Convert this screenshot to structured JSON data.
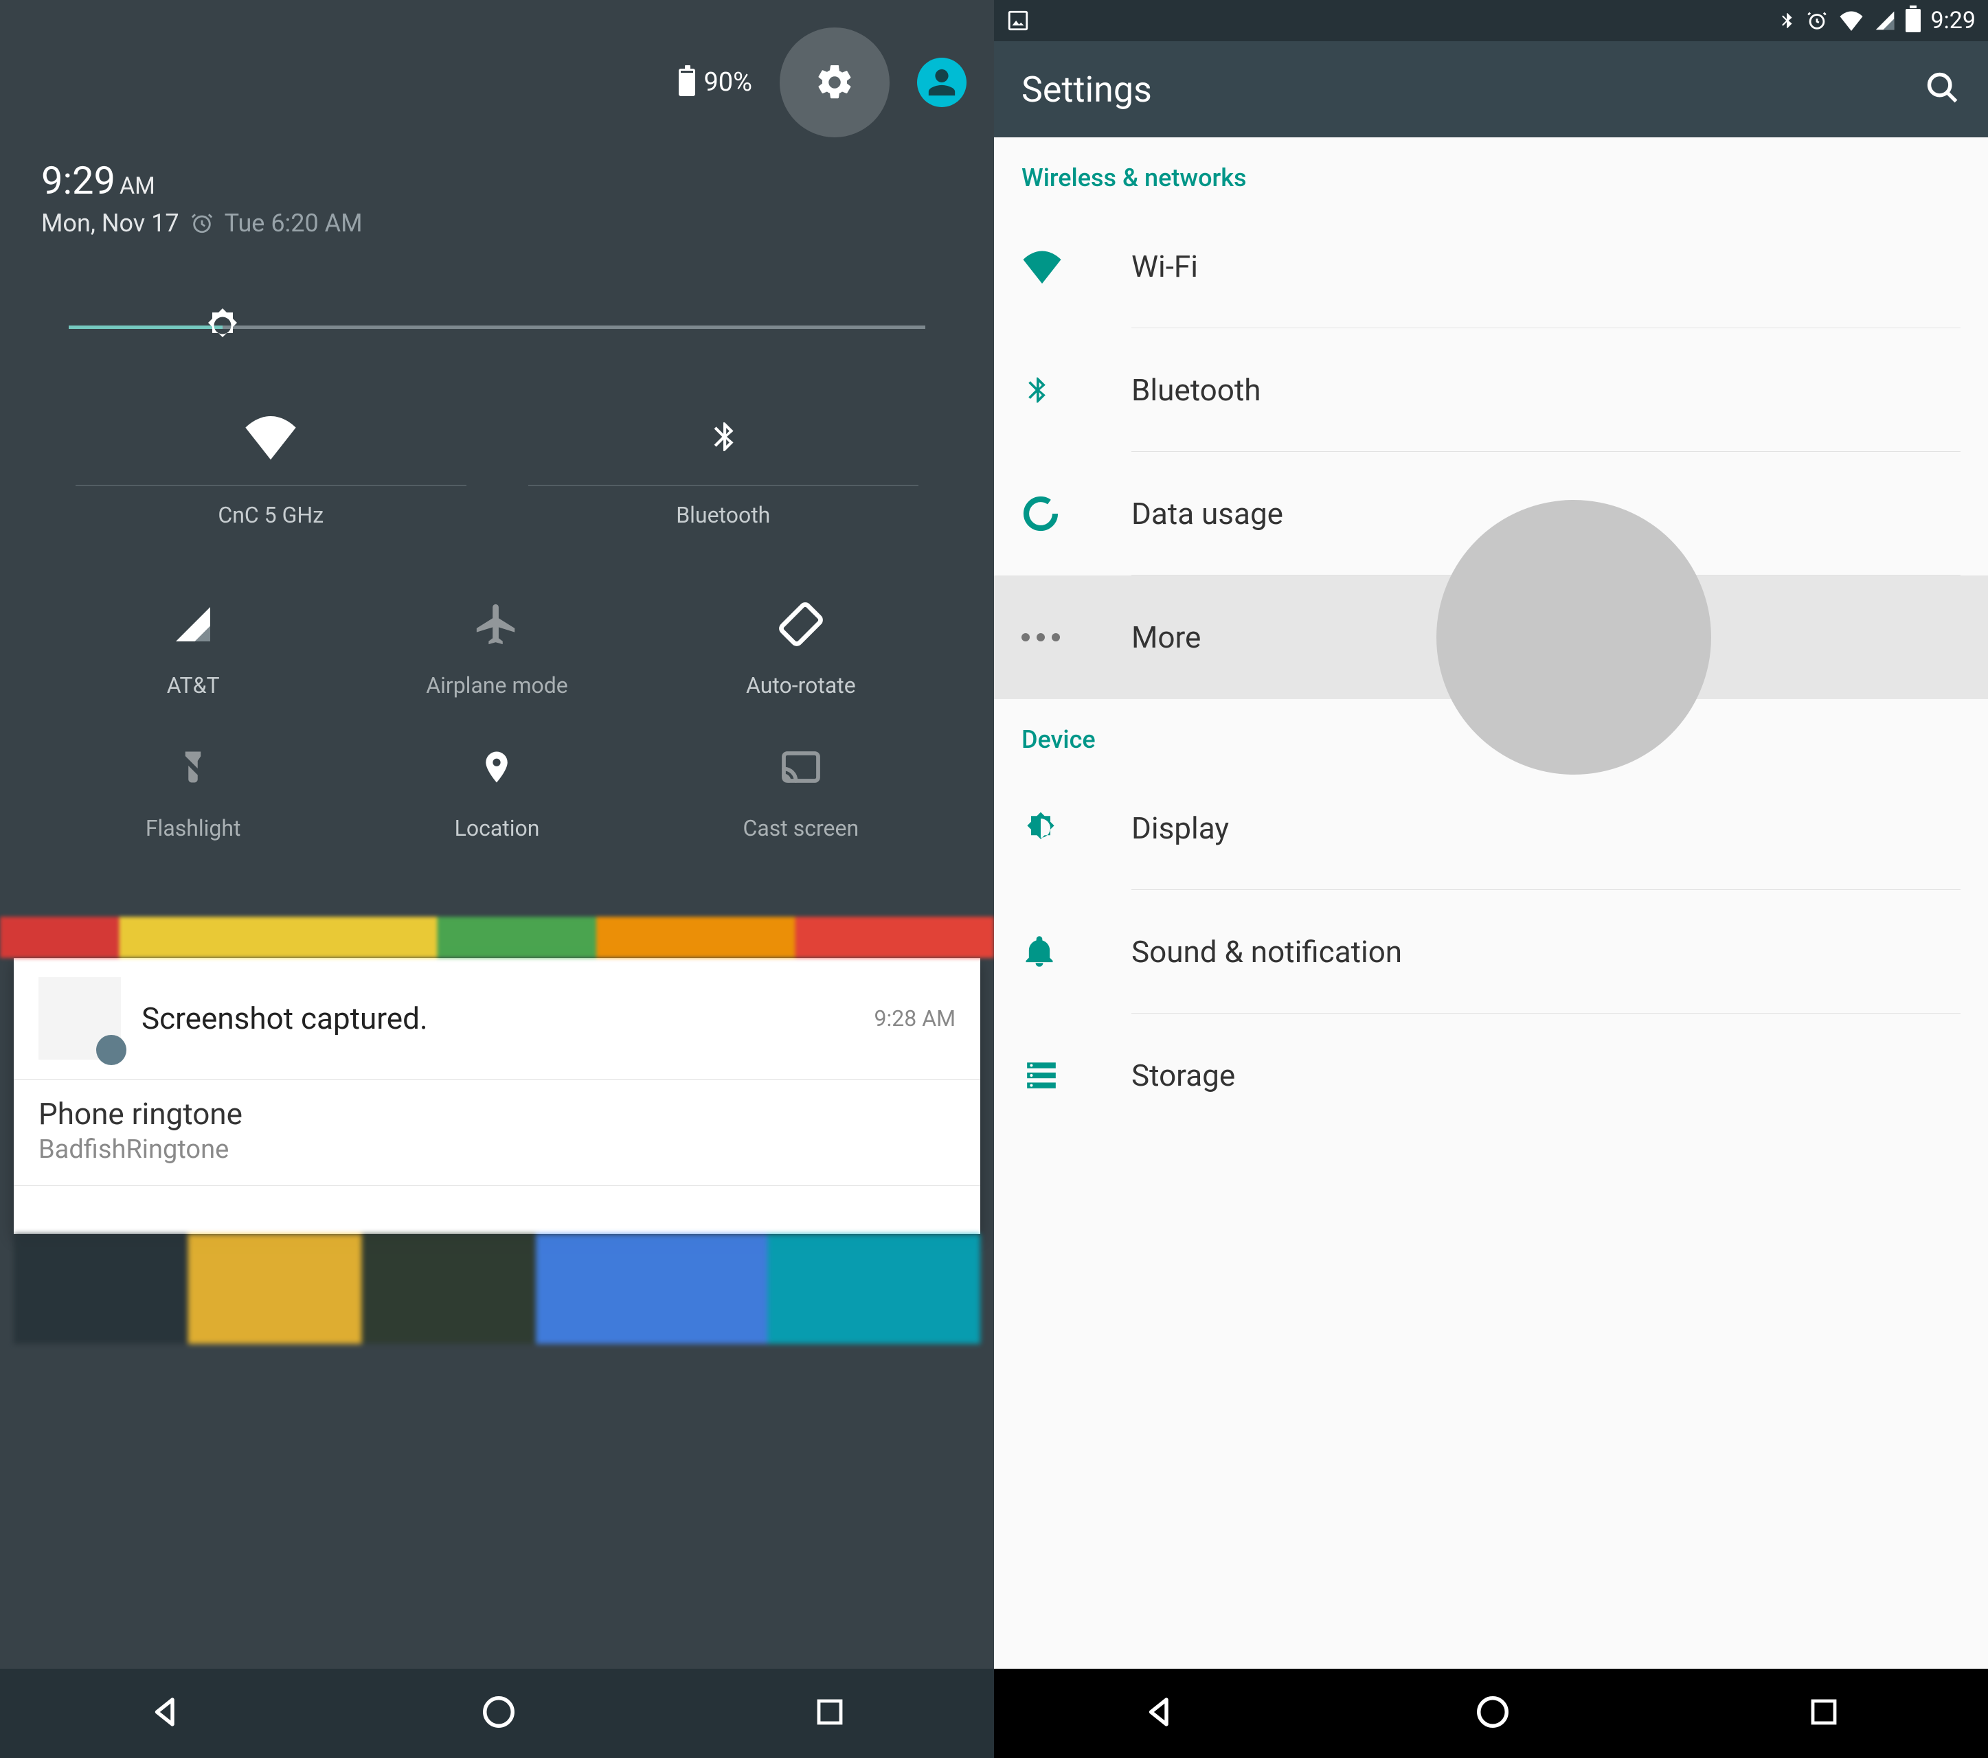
{
  "left": {
    "battery_pct": "90%",
    "time": "9:29",
    "ampm": "AM",
    "date": "Mon, Nov 17",
    "alarm": "Tue 6:20 AM",
    "brightness_pct": 18,
    "tiles_top": [
      {
        "label": "CnC 5 GHz"
      },
      {
        "label": "Bluetooth"
      }
    ],
    "tiles": [
      {
        "label": "AT&T"
      },
      {
        "label": "Airplane mode"
      },
      {
        "label": "Auto-rotate"
      },
      {
        "label": "Flashlight"
      },
      {
        "label": "Location"
      },
      {
        "label": "Cast screen"
      }
    ],
    "notif1": {
      "title": "Screenshot captured.",
      "time": "9:28 AM"
    },
    "notif2": {
      "title": "Phone ringtone",
      "sub": "BadfishRingtone"
    }
  },
  "right": {
    "statusbar_time": "9:29",
    "appbar_title": "Settings",
    "sections": {
      "wireless_header": "Wireless & networks",
      "device_header": "Device"
    },
    "items": {
      "wifi": "Wi-Fi",
      "bluetooth": "Bluetooth",
      "data": "Data usage",
      "more": "More",
      "display": "Display",
      "sound": "Sound & notification",
      "storage": "Storage"
    }
  },
  "colors": {
    "teal": "#009688",
    "teal_light": "#26a69a",
    "cyan": "#00bcd4",
    "panel": "#384248",
    "appbar": "#37474f"
  }
}
